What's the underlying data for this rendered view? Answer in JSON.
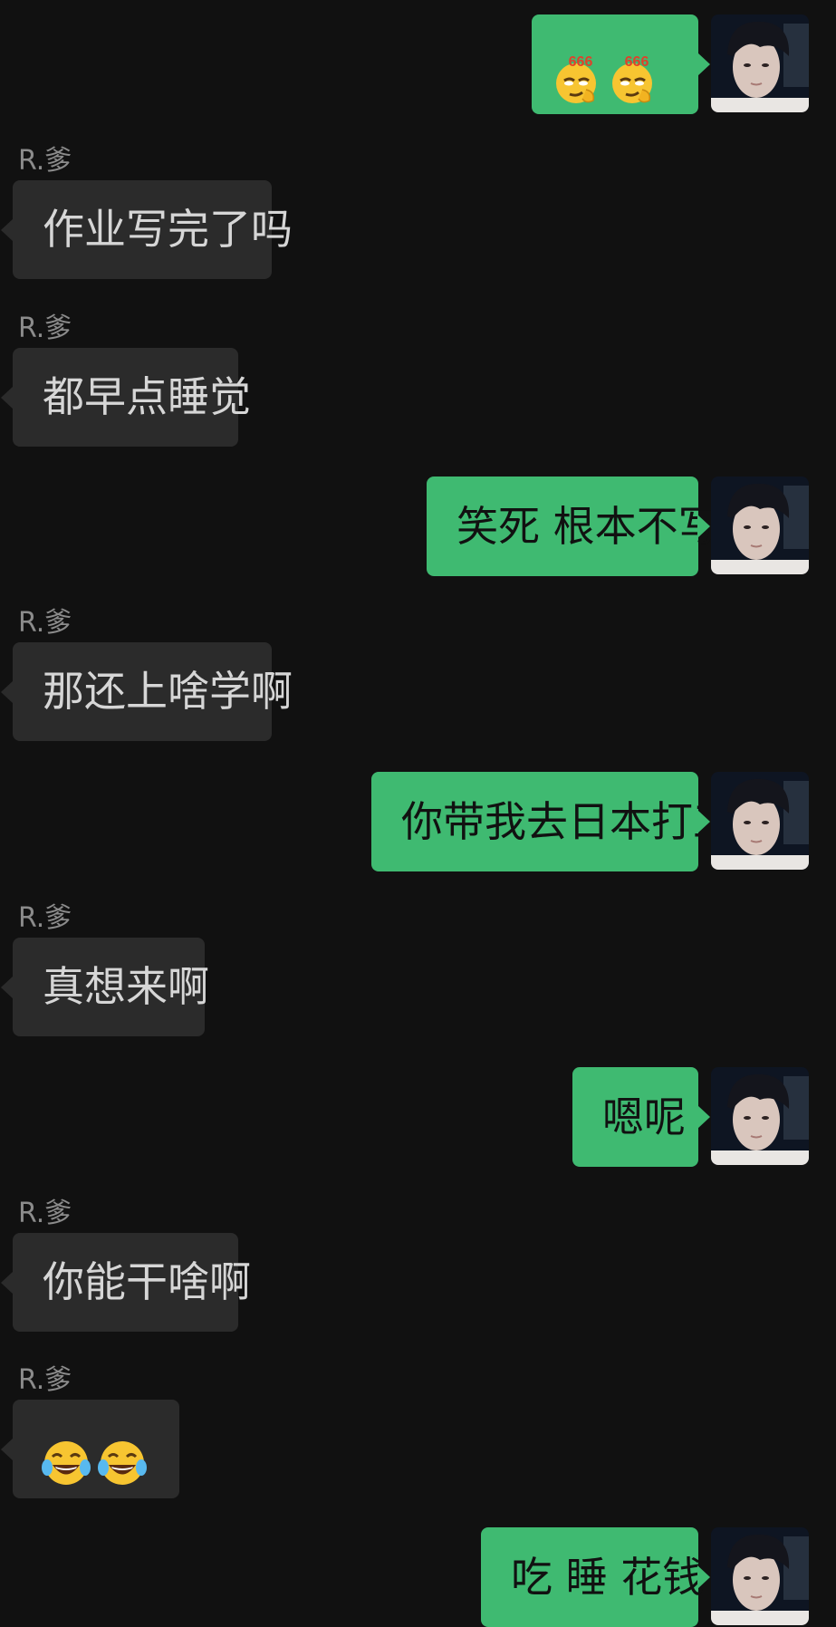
{
  "messages": [
    {
      "side": "self",
      "emoji": [
        "smirk-666-emoji",
        "smirk-666-emoji"
      ],
      "emoji_caption": "666"
    },
    {
      "side": "other",
      "sender": "R.爹",
      "text": "作业写完了吗"
    },
    {
      "side": "other",
      "sender": "R.爹",
      "text": "都早点睡觉"
    },
    {
      "side": "self",
      "text": "笑死 根本不写"
    },
    {
      "side": "other",
      "sender": "R.爹",
      "text": "那还上啥学啊"
    },
    {
      "side": "self",
      "text": "你带我去日本打工"
    },
    {
      "side": "other",
      "sender": "R.爹",
      "text": "真想来啊"
    },
    {
      "side": "self",
      "text": "嗯呢"
    },
    {
      "side": "other",
      "sender": "R.爹",
      "text": "你能干啥啊"
    },
    {
      "side": "other",
      "sender": "R.爹",
      "emoji": [
        "tears-of-joy-emoji",
        "tears-of-joy-emoji"
      ]
    },
    {
      "side": "self",
      "text": "吃 睡 花钱"
    }
  ],
  "colors": {
    "background": "#111111",
    "self_bubble": "#3fba71",
    "other_bubble": "#2b2b2b",
    "sender_text": "#8b8b8b",
    "other_text": "#d6d6d6"
  }
}
